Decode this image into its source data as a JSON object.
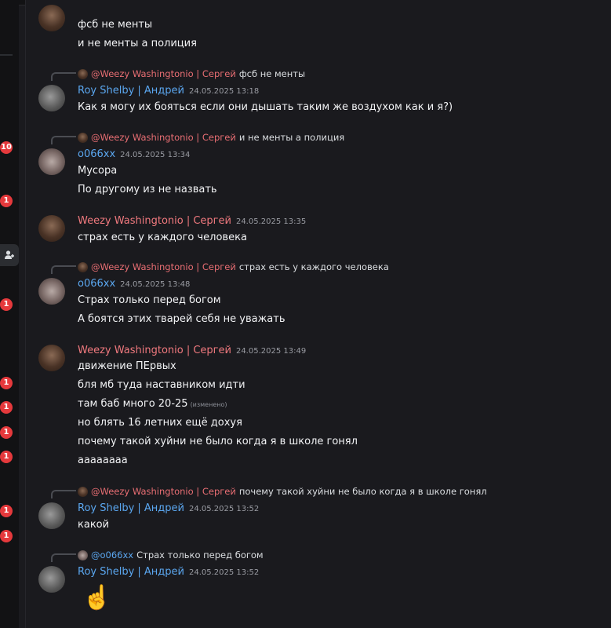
{
  "rail": {
    "badges": [
      "10",
      "1",
      "1",
      "1",
      "1",
      "1",
      "1",
      "1",
      "1"
    ]
  },
  "messages": {
    "m0": {
      "lines": [
        "фсб не менты",
        "и не менты а полиция"
      ]
    },
    "m1": {
      "reply_name": "@Weezy Washingtonio | Сергей",
      "reply_text": "фсб не менты",
      "author": "Roy Shelby | Андрей",
      "time": "24.05.2025 13:18",
      "lines": [
        "Как я могу их бояться если они дышать таким же воздухом как и я?)"
      ]
    },
    "m2": {
      "reply_name": "@Weezy Washingtonio | Сергей",
      "reply_text": "и не менты а полиция",
      "author": "о066xx",
      "time": "24.05.2025 13:34",
      "lines": [
        "Мусора",
        "По другому из не назвать"
      ]
    },
    "m3": {
      "author": "Weezy Washingtonio | Сергей",
      "time": "24.05.2025 13:35",
      "lines": [
        "страх есть у каждого человека"
      ]
    },
    "m4": {
      "reply_name": "@Weezy Washingtonio | Сергей",
      "reply_text": "страх есть у каждого человека",
      "author": "о066xx",
      "time": "24.05.2025 13:48",
      "lines": [
        "Страх только перед богом",
        "А боятся этих тварей себя не уважать"
      ]
    },
    "m5": {
      "author": "Weezy Washingtonio | Сергей",
      "time": "24.05.2025 13:49",
      "lines": [
        "движение ПЕрвых",
        "бля мб туда наставником идти",
        "там баб много 20-25",
        "но блять 16 летних ещё дохуя",
        "почему такой хуйни не было когда я в школе гонял",
        "ааааaaaa"
      ],
      "edited": "(изменено)"
    },
    "m6": {
      "reply_name": "@Weezy Washingtonio | Сергей",
      "reply_text": "почему такой хуйни не было когда я в школе гонял",
      "author": "Roy Shelby | Андрей",
      "time": "24.05.2025 13:52",
      "lines": [
        "какой"
      ]
    },
    "m7": {
      "reply_name": "@о066xx",
      "reply_text": "Страх только перед богом",
      "author": "Roy Shelby | Андрей",
      "time": "24.05.2025 13:52",
      "emoji": "☝️"
    }
  }
}
